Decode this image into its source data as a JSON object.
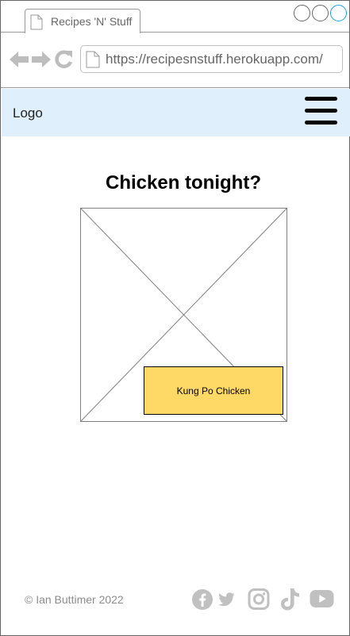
{
  "browser": {
    "tab_title": "Recipes 'N' Stuff",
    "url": "https://recipesnstuff.herokuapp.com/"
  },
  "header": {
    "logo_text": "Logo"
  },
  "main": {
    "title": "Chicken tonight?",
    "recipe_card_label": "Kung Po Chicken"
  },
  "footer": {
    "copyright": "© Ian Buttimer 2022",
    "social_icons": [
      "facebook-icon",
      "twitter-icon",
      "instagram-icon",
      "tiktok-icon",
      "youtube-icon"
    ]
  },
  "colors": {
    "header_bg": "#dff0fc",
    "card_bg": "#ffd966",
    "muted": "#8c8c8c",
    "icon_grey": "#c0c0c0"
  }
}
